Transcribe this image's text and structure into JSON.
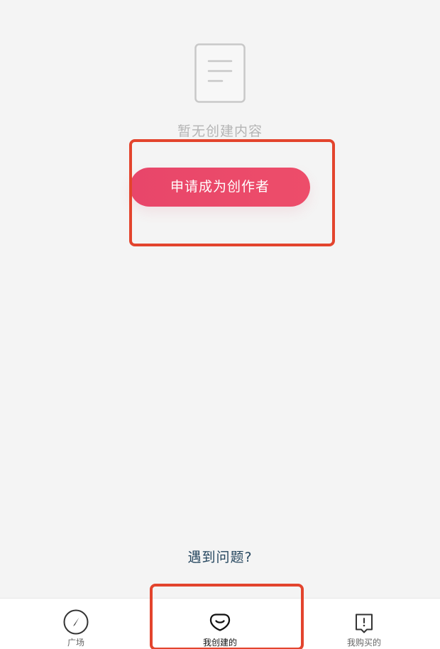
{
  "empty_state": {
    "icon": "document-icon",
    "text": "暂无创建内容"
  },
  "apply_button": {
    "label": "申请成为创作者"
  },
  "help": {
    "label": "遇到问题?"
  },
  "bottom_nav": {
    "items": [
      {
        "label": "广场",
        "icon": "compass-icon",
        "active": false
      },
      {
        "label": "我创建的",
        "icon": "heart-shield-icon",
        "active": true
      },
      {
        "label": "我购买的",
        "icon": "chat-bubble-icon",
        "active": false
      }
    ]
  },
  "colors": {
    "page_background": "#f4f4f4",
    "accent": "#e8466a",
    "highlight": "#e3442d",
    "help_text": "#26475f"
  }
}
